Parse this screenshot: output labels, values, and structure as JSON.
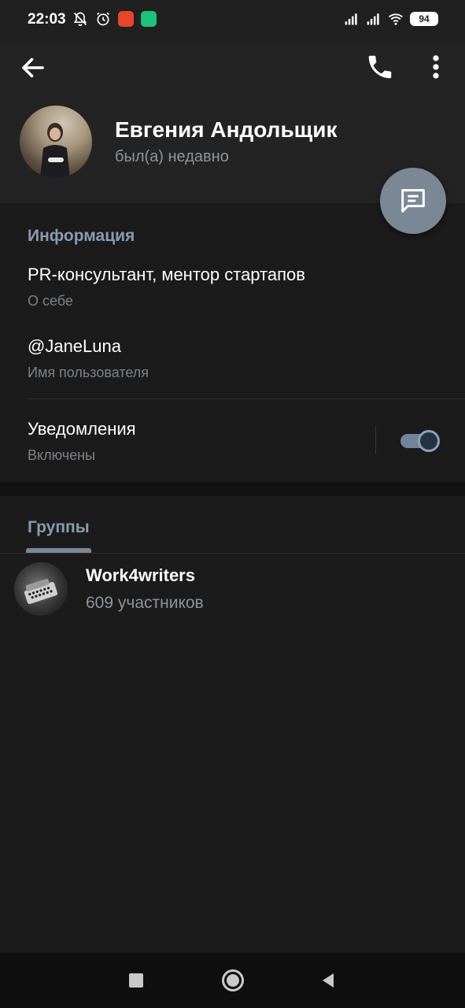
{
  "status_bar": {
    "time": "22:03",
    "battery": "94",
    "left_icons": [
      "bell-off-icon",
      "alarm-icon",
      "mail-app-icon",
      "check-app-icon"
    ],
    "right_icons": [
      "signal-icon",
      "signal-icon",
      "wifi-icon"
    ]
  },
  "header": {
    "name": "Евгения Андольщик",
    "last_seen": "был(а) недавно",
    "icons": [
      "arrow-left-icon",
      "phone-icon",
      "more-vertical-icon",
      "message-icon"
    ]
  },
  "info": {
    "section_title": "Информация",
    "bio": "PR-консультант, ментор стартапов",
    "bio_label": "О себе",
    "username": "@JaneLuna",
    "username_label": "Имя пользователя",
    "notifications": "Уведомления",
    "notifications_state": "Включены",
    "notifications_enabled": true
  },
  "groups": {
    "section_title": "Группы",
    "items": [
      {
        "name": "Work4writers",
        "members": "609 участников"
      }
    ]
  },
  "colors": {
    "accent": "#7b8795",
    "section_title": "#8a9bb0",
    "background": "#1b1b1b",
    "header_background": "#232323"
  }
}
